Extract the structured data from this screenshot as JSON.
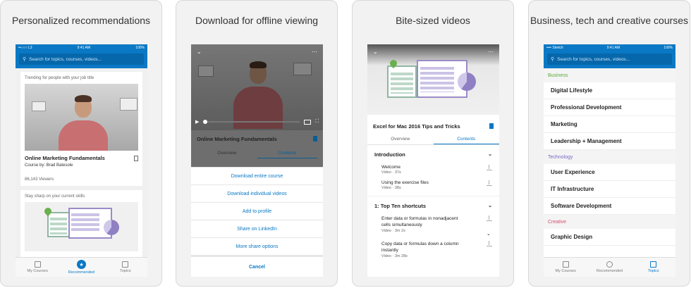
{
  "cards": [
    {
      "caption": "Personalized recommendations",
      "status": {
        "carrier": "••○○○ L3 ",
        "time": "9:41 AM",
        "battery": "100%"
      },
      "search_placeholder": "Search for topics, courses, videos...",
      "section1": "Trending for people with your job title",
      "course_title": "Online Marketing Fundamentals",
      "course_by": "Course by:",
      "course_author": "Brad Batesole",
      "viewers": "86,143 Viewers",
      "section2": "Stay sharp on your current skills",
      "tabs": [
        "My Courses",
        "Recommended",
        "Topics"
      ]
    },
    {
      "caption": "Download for offline viewing",
      "video_title": "Online Marketing Fundamentals",
      "tabs": [
        "Overview",
        "Contents"
      ],
      "actions": [
        "Download entire course",
        "Download individual videos",
        "Add to profile",
        "Share on LinkedIn",
        "More share options",
        "Cancel"
      ]
    },
    {
      "caption": "Bite-sized videos",
      "course_title": "Excel for Mac 2016 Tips and Tricks",
      "tabs": [
        "Overview",
        "Contents"
      ],
      "intro": "Introduction",
      "videos": [
        {
          "title": "Welcome",
          "meta": "Video · 37s"
        },
        {
          "title": "Using the exercise files",
          "meta": "Video · 38s"
        }
      ],
      "chapter": "1:  Top Ten shortcuts",
      "videos2": [
        {
          "title": "Enter data or formulas in nonadjacent cells simultaneously",
          "meta": "Video · 3m 2s"
        },
        {
          "title": "Copy data or formulas down a column instantly",
          "meta": "Video · 3m 28s"
        }
      ]
    },
    {
      "caption": "Business, tech and creative courses",
      "status": {
        "carrier": "•••• Sketch ",
        "time": "9:41 AM",
        "battery": "100%"
      },
      "search_placeholder": "Search for topics, courses, videos...",
      "groups": [
        {
          "name": "Business",
          "color": "#5aa93c",
          "items": [
            "Digital Lifestyle",
            "Professional Development",
            "Marketing",
            "Leadership + Management"
          ]
        },
        {
          "name": "Technology",
          "color": "#7b68c4",
          "items": [
            "User Experience",
            "IT Infrastructure",
            "Software Development"
          ]
        },
        {
          "name": "Creative",
          "color": "#d2506f",
          "items": [
            "Graphic Design"
          ]
        }
      ],
      "tabs": [
        "My Courses",
        "Recommended",
        "Topics"
      ]
    }
  ],
  "colors": {
    "accent": "#0a78c4"
  }
}
